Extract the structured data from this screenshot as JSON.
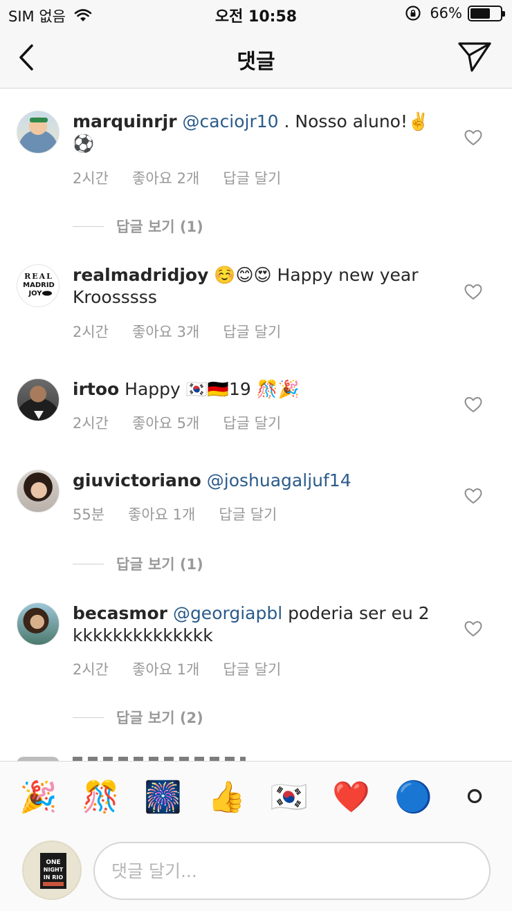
{
  "status_bar": {
    "carrier": "SIM 없음",
    "time": "오전 10:58",
    "battery": "66%",
    "battery_level": 0.66
  },
  "nav": {
    "title": "댓글"
  },
  "comments": [
    {
      "username": "marquinrjr",
      "mention": "@caciojr10",
      "text": " . Nosso aluno!✌️⚽",
      "time": "2시간",
      "likes": "좋아요 2개",
      "reply": "답글 달기",
      "view_replies": "답글 보기 (1)"
    },
    {
      "username": "realmadridjoy",
      "mention": "",
      "text": " ☺️😊😍 Happy new year Kroosssss",
      "time": "2시간",
      "likes": "좋아요 3개",
      "reply": "답글 달기",
      "avatar_text": "REAL MADRID JOY"
    },
    {
      "username": "irtoo",
      "mention": "",
      "text": " Happy 🇰🇷🇩🇪19 🎊🎉",
      "time": "2시간",
      "likes": "좋아요 5개",
      "reply": "답글 달기"
    },
    {
      "username": "giuvictoriano",
      "mention": "@joshuagaljuf14",
      "text": "",
      "time": "55분",
      "likes": "좋아요 1개",
      "reply": "답글 달기",
      "view_replies": "답글 보기 (1)"
    },
    {
      "username": "becasmor",
      "mention": "@georgiapbl",
      "text": " poderia ser eu 2 kkkkkkkkkkkkkk",
      "time": "2시간",
      "likes": "좋아요 1개",
      "reply": "답글 달기",
      "view_replies": "답글 보기 (2)"
    }
  ],
  "quick_emojis": [
    "🎉",
    "🎊",
    "🎆",
    "👍",
    "🇰🇷",
    "❤️",
    "🔵",
    "⚪"
  ],
  "composer": {
    "placeholder": "댓글 달기...",
    "avatar_text": "ONE NIGHT IN RIO"
  },
  "colors": {
    "mention": "#2a5b8a",
    "meta": "#999999",
    "text": "#262626"
  }
}
